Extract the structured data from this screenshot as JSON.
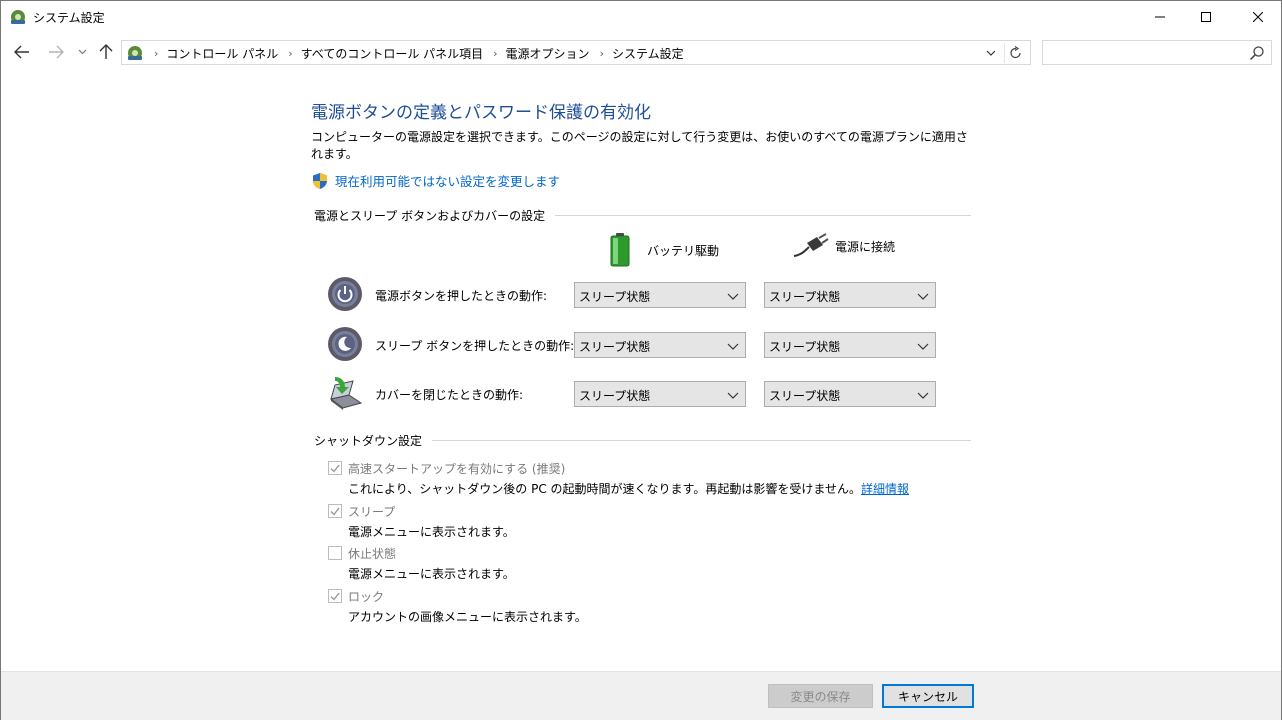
{
  "window": {
    "title": "システム設定"
  },
  "nav": {
    "breadcrumbs": [
      "コントロール パネル",
      "すべてのコントロール パネル項目",
      "電源オプション",
      "システム設定"
    ],
    "search_placeholder": ""
  },
  "main": {
    "heading": "電源ボタンの定義とパスワード保護の有効化",
    "description": "コンピューターの電源設定を選択できます。このページの設定に対して行う変更は、お使いのすべての電源プランに適用されます。",
    "change_link": "現在利用可能ではない設定を変更します",
    "buttons_section": "電源とスリープ ボタンおよびカバーの設定",
    "col_battery": "バッテリ駆動",
    "col_plugged": "電源に接続",
    "rows": [
      {
        "label": "電源ボタンを押したときの動作:",
        "battery": "スリープ状態",
        "plugged": "スリープ状態"
      },
      {
        "label": "スリープ ボタンを押したときの動作:",
        "battery": "スリープ状態",
        "plugged": "スリープ状態"
      },
      {
        "label": "カバーを閉じたときの動作:",
        "battery": "スリープ状態",
        "plugged": "スリープ状態"
      }
    ],
    "shutdown_section": "シャットダウン設定",
    "options": [
      {
        "label": "高速スタートアップを有効にする (推奨)",
        "checked": true,
        "desc": "これにより、シャットダウン後の PC の起動時間が速くなります。再起動は影響を受けません。",
        "link": "詳細情報"
      },
      {
        "label": "スリープ",
        "checked": true,
        "desc": "電源メニューに表示されます。"
      },
      {
        "label": "休止状態",
        "checked": false,
        "desc": "電源メニューに表示されます。"
      },
      {
        "label": "ロック",
        "checked": true,
        "desc": "アカウントの画像メニューに表示されます。"
      }
    ]
  },
  "footer": {
    "save_label": "変更の保存",
    "cancel_label": "キャンセル"
  },
  "colors": {
    "accent": "#0078d7",
    "link": "#0066cc",
    "heading": "#1f4e99"
  }
}
